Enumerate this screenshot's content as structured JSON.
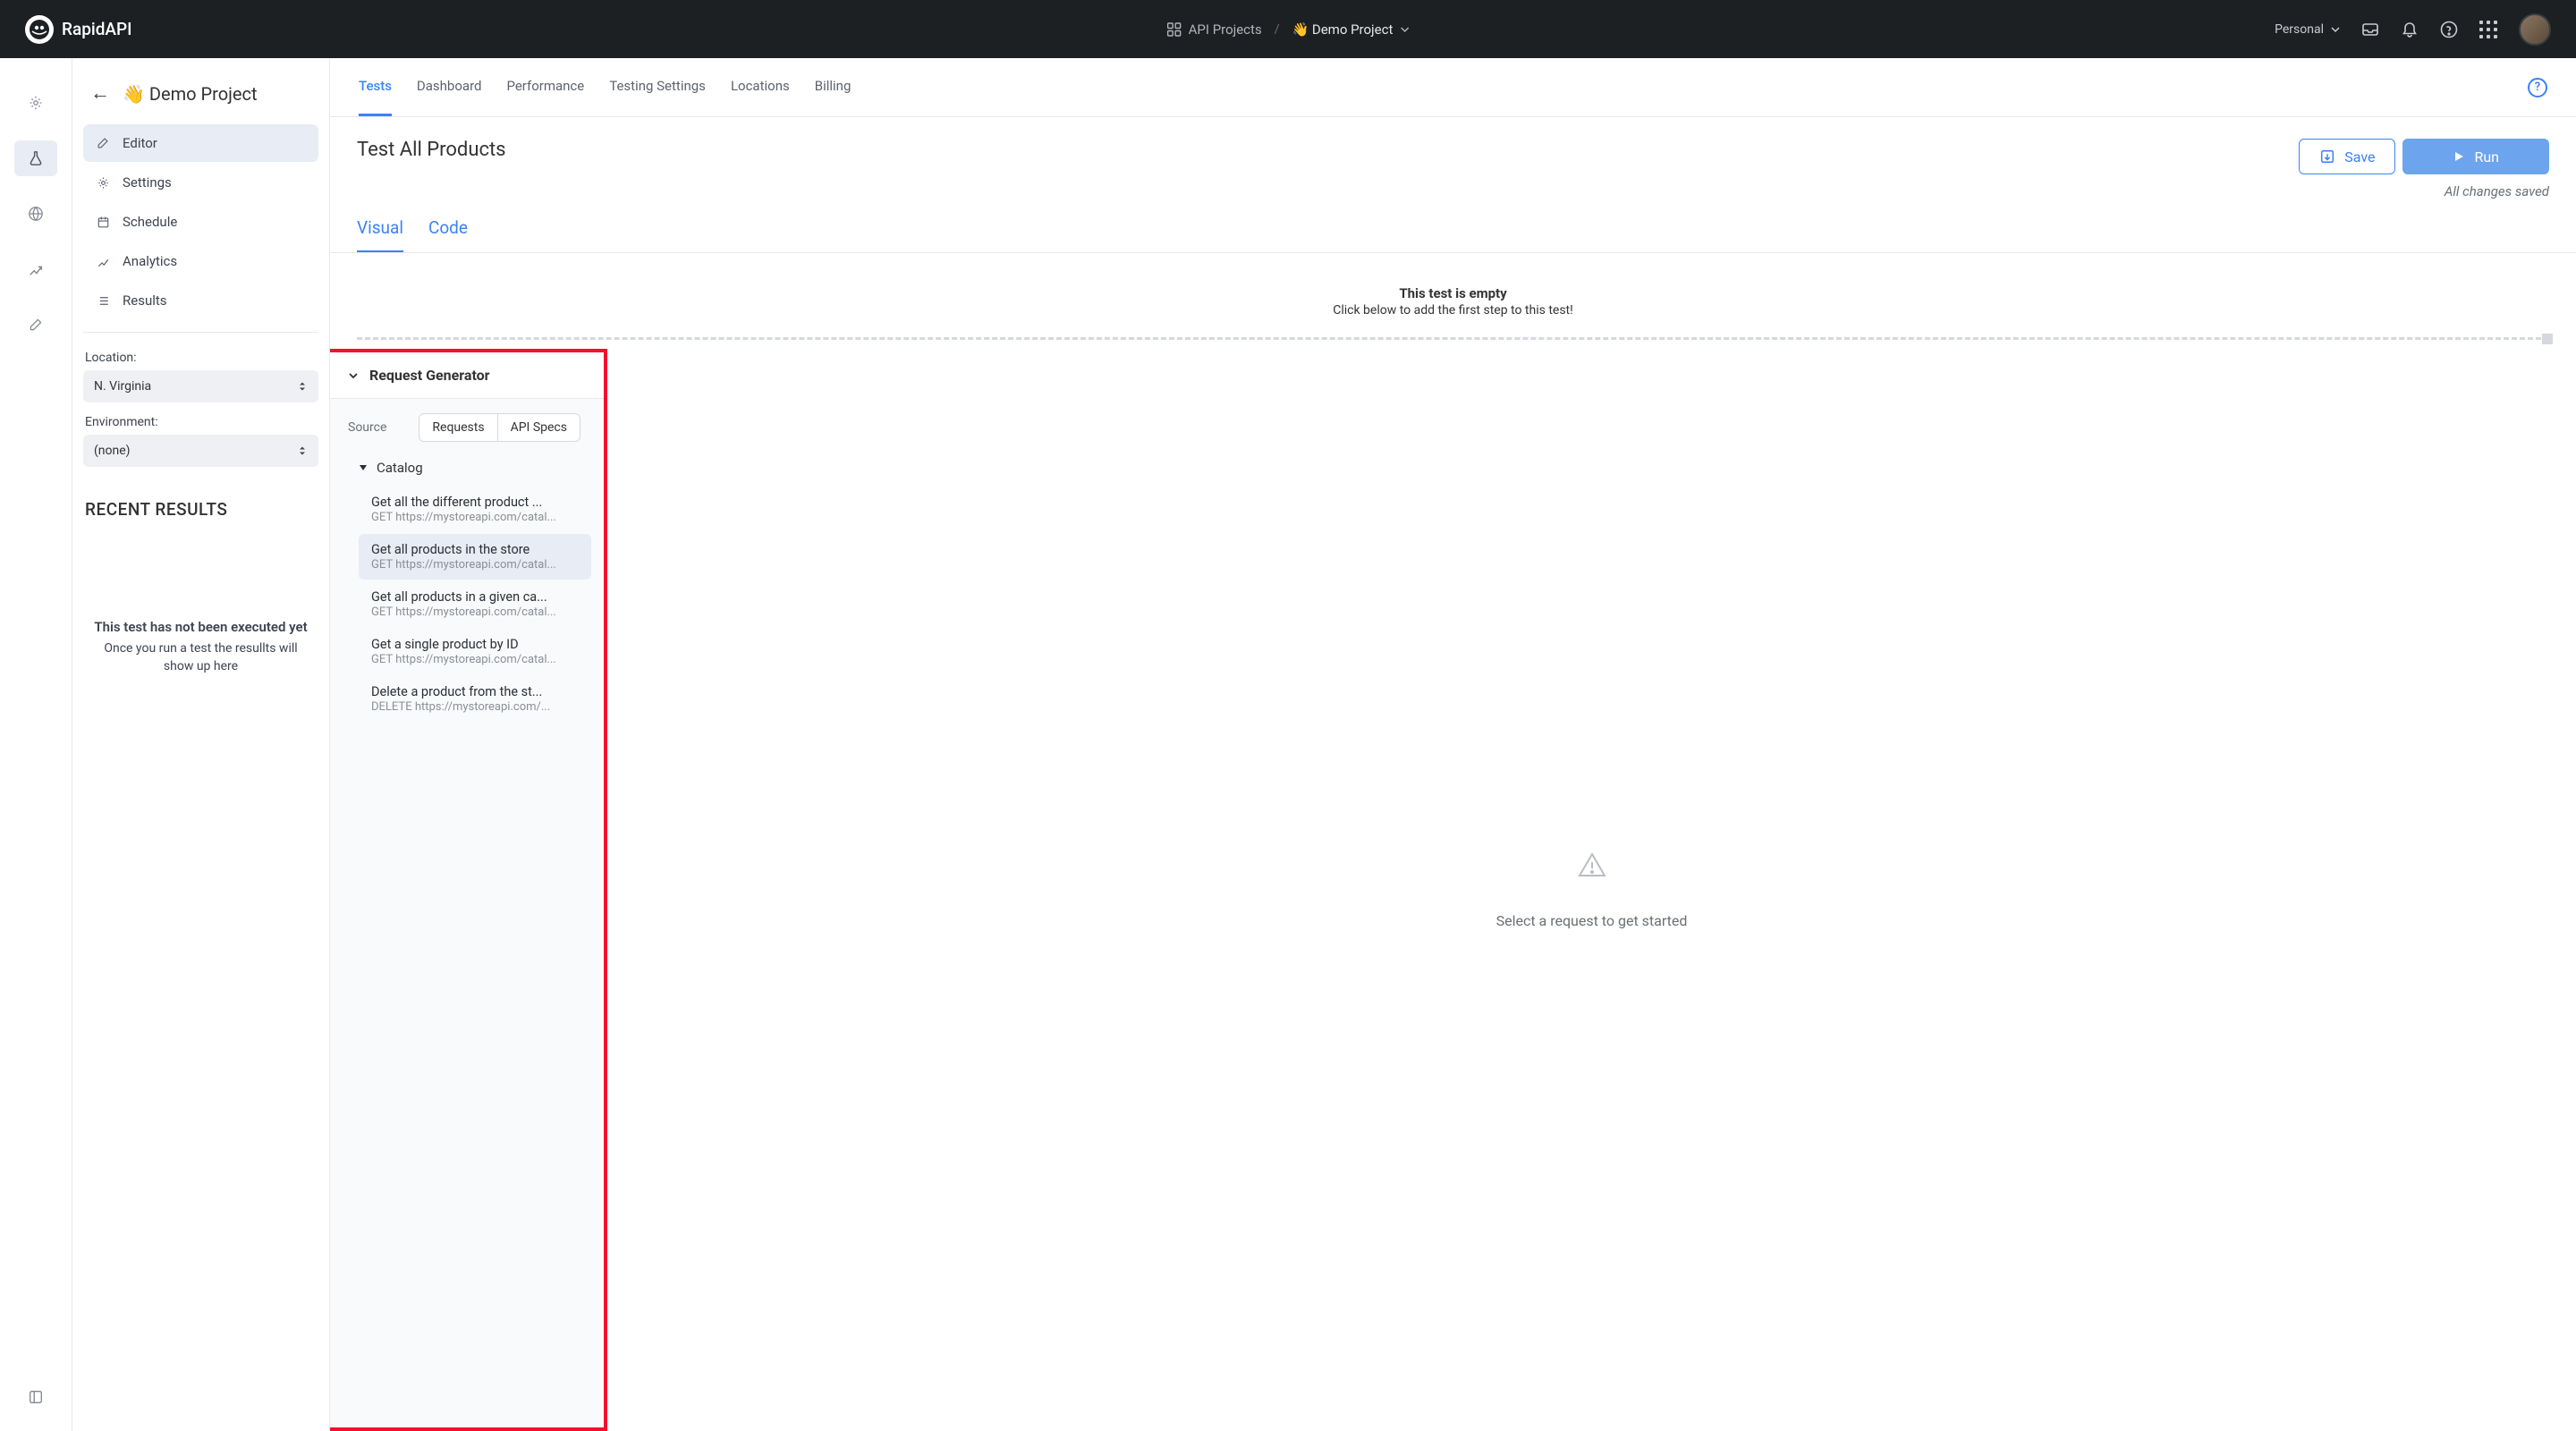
{
  "header": {
    "brand": "RapidAPI",
    "breadcrumb": {
      "projects": "API Projects",
      "current": "👋 Demo Project"
    },
    "workspace": "Personal"
  },
  "tabs": [
    "Tests",
    "Dashboard",
    "Performance",
    "Testing Settings",
    "Locations",
    "Billing"
  ],
  "active_tab": "Tests",
  "project": {
    "title": "👋 Demo Project"
  },
  "side_items": [
    {
      "label": "Editor",
      "icon": "pencil",
      "active": true
    },
    {
      "label": "Settings",
      "icon": "gear",
      "active": false
    },
    {
      "label": "Schedule",
      "icon": "calendar",
      "active": false
    },
    {
      "label": "Analytics",
      "icon": "chart",
      "active": false
    },
    {
      "label": "Results",
      "icon": "list",
      "active": false
    }
  ],
  "location": {
    "label": "Location:",
    "value": "N. Virginia"
  },
  "environment": {
    "label": "Environment:",
    "value": "(none)"
  },
  "recent": {
    "header": "RECENT RESULTS",
    "empty_title": "This test has not been executed yet",
    "empty_sub": "Once you run a test the resullts will show up here"
  },
  "content": {
    "title": "Test All Products",
    "save": "Save",
    "run": "Run",
    "saved": "All changes saved",
    "subtabs": [
      "Visual",
      "Code"
    ],
    "active_subtab": "Visual",
    "empty_title": "This test is empty",
    "empty_sub": "Click below to add the first step to this test!"
  },
  "request_generator": {
    "header": "Request Generator",
    "source_label": "Source",
    "seg": {
      "requests": "Requests",
      "specs": "API Specs"
    },
    "group": "Catalog",
    "endpoints": [
      {
        "title": "Get all the different product ...",
        "method": "GET",
        "url": "https://mystoreapi.com/catal...",
        "hl": false
      },
      {
        "title": "Get all products in the store",
        "method": "GET",
        "url": "https://mystoreapi.com/catal...",
        "hl": true
      },
      {
        "title": "Get all products in a given ca...",
        "method": "GET",
        "url": "https://mystoreapi.com/catal...",
        "hl": false
      },
      {
        "title": "Get a single product by ID",
        "method": "GET",
        "url": "https://mystoreapi.com/catal...",
        "hl": false
      },
      {
        "title": "Delete a product from the st...",
        "method": "DELETE",
        "url": "https://mystoreapi.com/...",
        "hl": false
      }
    ]
  },
  "lower_right": {
    "msg": "Select a request to get started"
  }
}
